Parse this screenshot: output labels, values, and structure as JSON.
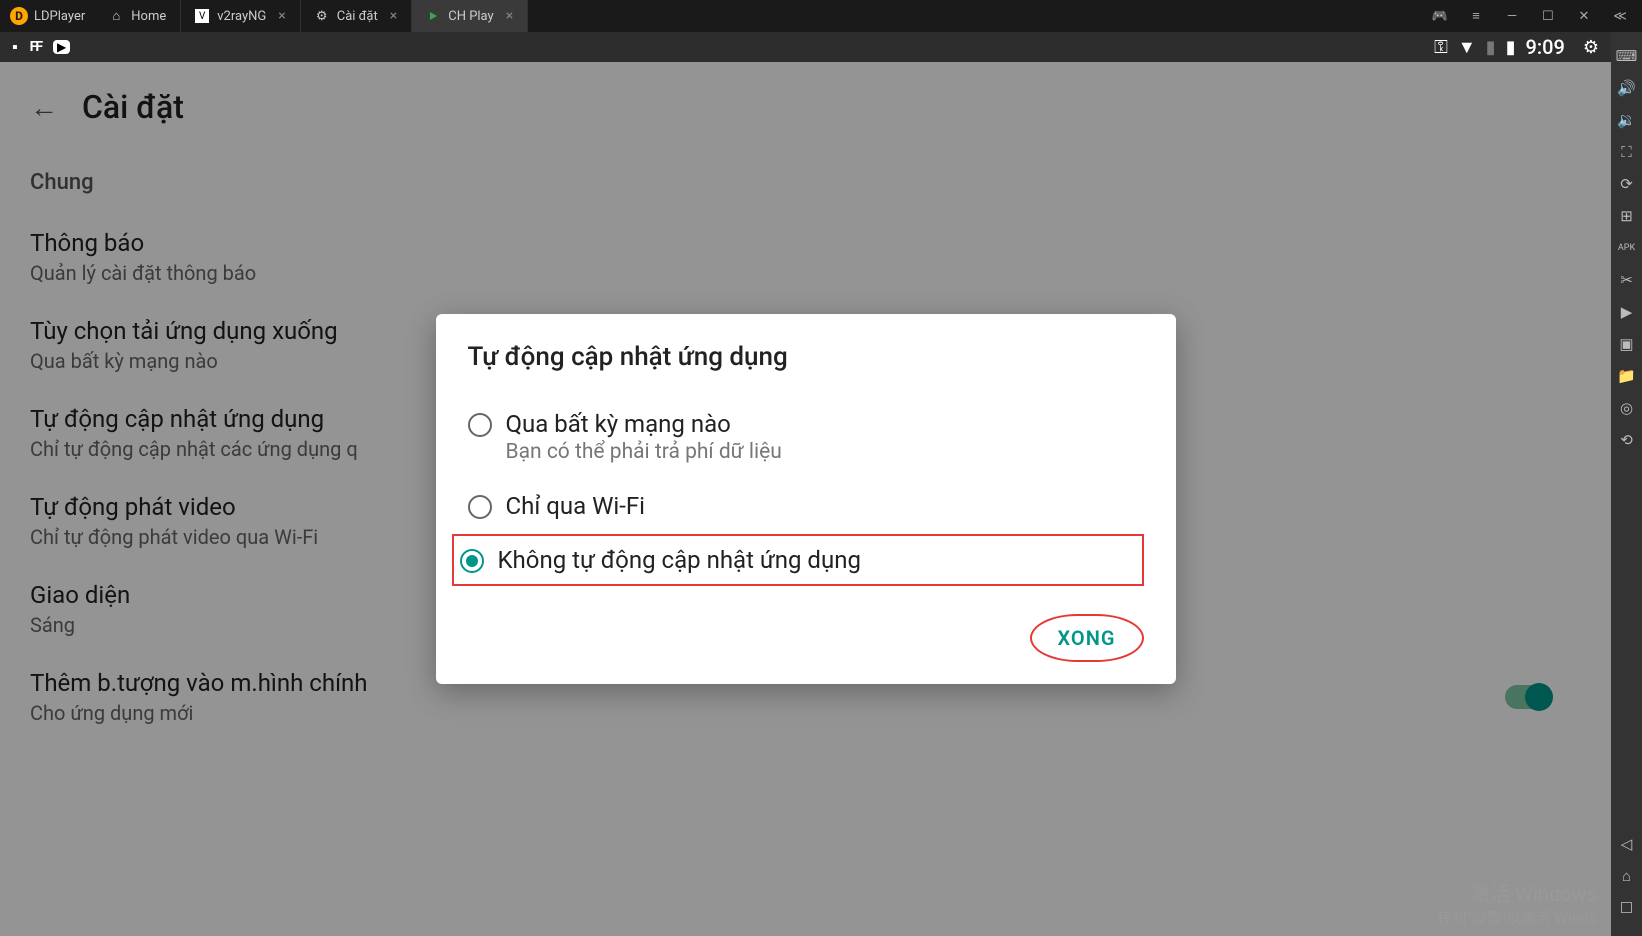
{
  "app_name": "LDPlayer",
  "tabs": [
    {
      "label": "Home",
      "active": false,
      "closeable": false
    },
    {
      "label": "v2rayNG",
      "active": false,
      "closeable": true
    },
    {
      "label": "Cài đặt",
      "active": false,
      "closeable": true
    },
    {
      "label": "CH Play",
      "active": true,
      "closeable": true
    }
  ],
  "statusbar": {
    "time": "9:09"
  },
  "page": {
    "title": "Cài đặt",
    "section": "Chung",
    "items": [
      {
        "title": "Thông báo",
        "subtitle": "Quản lý cài đặt thông báo"
      },
      {
        "title": "Tùy chọn tải ứng dụng xuống",
        "subtitle": "Qua bất kỳ mạng nào"
      },
      {
        "title": "Tự động cập nhật ứng dụng",
        "subtitle": "Chỉ tự động cập nhật các ứng dụng q"
      },
      {
        "title": "Tự động phát video",
        "subtitle": "Chỉ tự động phát video qua Wi-Fi"
      },
      {
        "title": "Giao diện",
        "subtitle": "Sáng"
      },
      {
        "title": "Thêm b.tượng vào m.hình chính",
        "subtitle": "Cho ứng dụng mới",
        "toggle": true
      }
    ]
  },
  "dialog": {
    "title": "Tự động cập nhật ứng dụng",
    "options": [
      {
        "label": "Qua bất kỳ mạng nào",
        "sublabel": "Bạn có thể phải trả phí dữ liệu",
        "selected": false,
        "highlighted": false
      },
      {
        "label": "Chỉ qua Wi-Fi",
        "sublabel": "",
        "selected": false,
        "highlighted": false
      },
      {
        "label": "Không tự động cập nhật ứng dụng",
        "sublabel": "",
        "selected": true,
        "highlighted": true
      }
    ],
    "done": "XONG"
  },
  "watermark": {
    "line1": "激活 Windows",
    "line2": "转到\"设置\"以激活 Windo"
  }
}
